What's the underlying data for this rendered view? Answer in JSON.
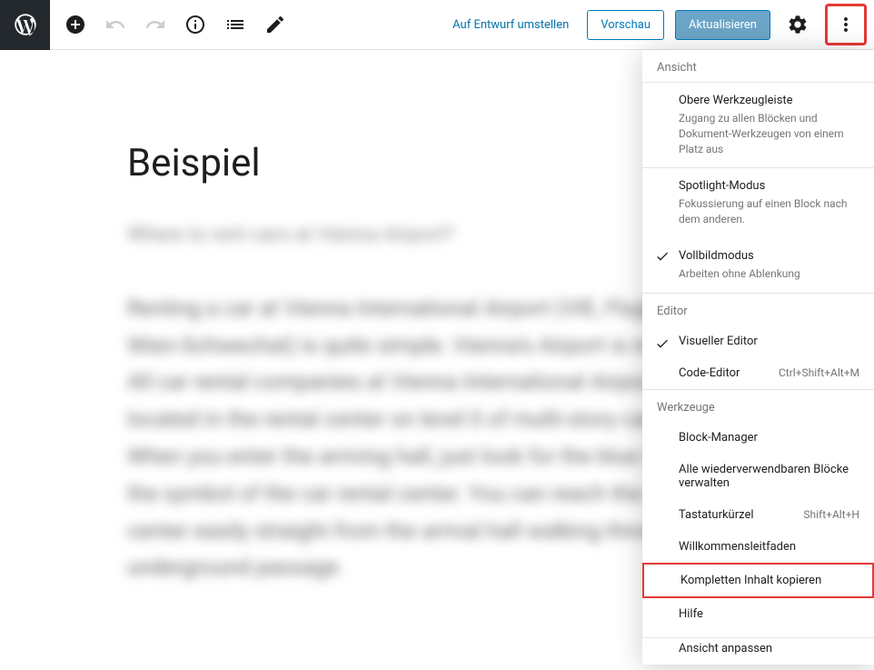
{
  "toolbar": {
    "draft_link": "Auf Entwurf umstellen",
    "preview": "Vorschau",
    "update": "Aktualisieren"
  },
  "content": {
    "title": "Beispiel",
    "blurred_heading": "Where to rent cars at Vienna Airport?",
    "blurred_body": "Renting a car at Vienna International Airport (VIE, Flughafen Wien, Wien-Schwechat) is quite simple. Vienna's Airport is not very big. All car rental companies at Vienna International Airport are located in the rental center on level 0 of multi-story car park 4. When you enter the arriving hall, just look for the blue signs or for the symbol of the car rental center. You can reach the car rental center easily straight from the arrival hall walking through a short underground passage."
  },
  "dropdown": {
    "sections": {
      "view": "Ansicht",
      "editor": "Editor",
      "tools": "Werkzeuge"
    },
    "items": {
      "top_toolbar": {
        "title": "Obere Werkzeugleiste",
        "desc": "Zugang zu allen Blöcken und Dokument-Werkzeugen von einem Platz aus"
      },
      "spotlight": {
        "title": "Spotlight-Modus",
        "desc": "Fokussierung auf einen Block nach dem anderen."
      },
      "fullscreen": {
        "title": "Vollbildmodus",
        "desc": "Arbeiten ohne Ablenkung"
      },
      "visual_editor": "Visueller Editor",
      "code_editor": {
        "label": "Code-Editor",
        "shortcut": "Ctrl+Shift+Alt+M"
      },
      "block_manager": "Block-Manager",
      "reusable_blocks": "Alle wiederverwendbaren Blöcke verwalten",
      "keyboard": {
        "label": "Tastaturkürzel",
        "shortcut": "Shift+Alt+H"
      },
      "welcome": "Willkommensleitfaden",
      "copy_all": "Kompletten Inhalt kopieren",
      "help": "Hilfe",
      "customize_view": "Ansicht anpassen"
    }
  }
}
